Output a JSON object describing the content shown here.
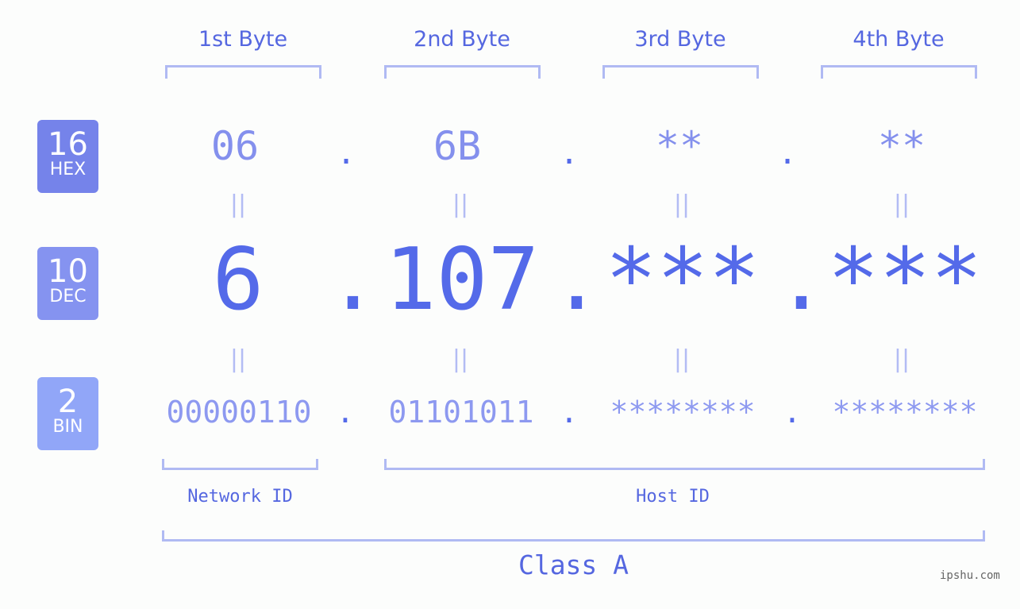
{
  "byte_headers": [
    "1st Byte",
    "2nd Byte",
    "3rd Byte",
    "4th Byte"
  ],
  "badges": {
    "hex": {
      "number": "16",
      "label": "HEX",
      "color": "#7583ea"
    },
    "dec": {
      "number": "10",
      "label": "DEC",
      "color": "#8593f0"
    },
    "bin": {
      "number": "2",
      "label": "BIN",
      "color": "#91a6f8"
    }
  },
  "hex_values": [
    "06",
    "6B",
    "**",
    "**"
  ],
  "dec_values": [
    "6",
    "107",
    "***",
    "***"
  ],
  "bin_values": [
    "00000110",
    "01101011",
    "********",
    "********"
  ],
  "separator": ".",
  "equals": "=",
  "labels": {
    "network_id": "Network ID",
    "host_id": "Host ID",
    "class": "Class A"
  },
  "watermark": "ipshu.com"
}
